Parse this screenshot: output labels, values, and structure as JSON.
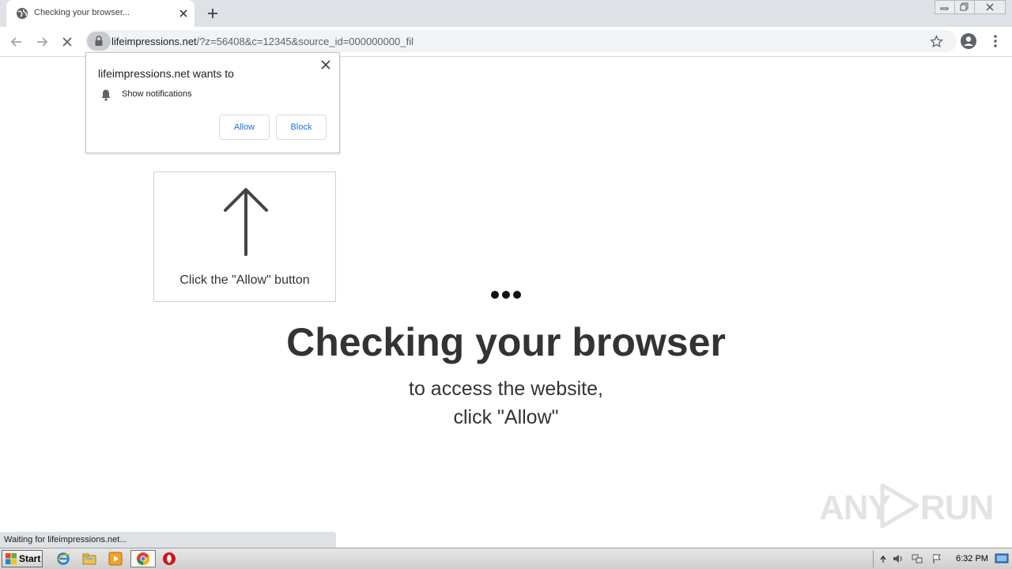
{
  "browser": {
    "tab": {
      "title": "Checking your browser..."
    },
    "url": {
      "host": "lifeimpressions.net",
      "path": "/?z=56408&c=12345&source_id=000000000_fil"
    },
    "status_text": "Waiting for lifeimpressions.net..."
  },
  "permission_prompt": {
    "title": "lifeimpressions.net wants to",
    "permission": "Show notifications",
    "allow_label": "Allow",
    "block_label": "Block"
  },
  "page": {
    "hint": "Click the \"Allow\" button",
    "heading": "Checking your browser",
    "sub_line1": "to access the website,",
    "sub_line2": "click \"Allow\""
  },
  "watermark": {
    "left": "ANY",
    "right": "RUN"
  },
  "taskbar": {
    "start_label": "Start",
    "clock": "6:32 PM",
    "pinned": [
      "ie-icon",
      "explorer-icon",
      "media-player-icon",
      "chrome-icon",
      "opera-icon"
    ]
  },
  "colors": {
    "link_blue": "#1a73e8",
    "tab_strip": "#dee1e6",
    "text_dark": "#333333"
  }
}
